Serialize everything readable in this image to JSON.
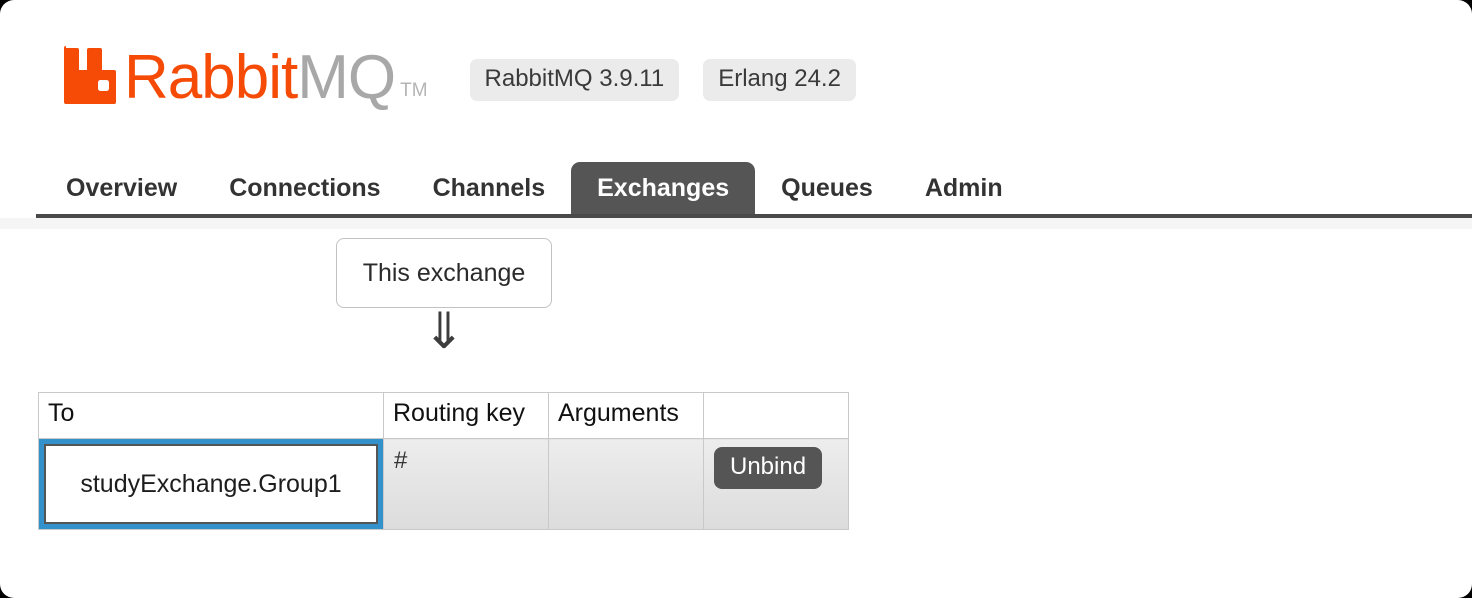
{
  "app": {
    "logo": {
      "mark_icon": "rabbitmq-bunny-icon",
      "text_primary": "Rabbit",
      "text_secondary": "MQ",
      "trademark": "TM"
    },
    "badges": [
      {
        "label": "RabbitMQ 3.9.11"
      },
      {
        "label": "Erlang 24.2"
      }
    ],
    "colors": {
      "brand_orange": "#f54b07",
      "logo_gray": "#a8a8a8",
      "tab_active_bg": "#555555",
      "selection_blue": "#3391cc",
      "button_bg": "#555555",
      "row_bg": "#e4e4e4"
    }
  },
  "nav": {
    "tabs": [
      {
        "label": "Overview",
        "active": false
      },
      {
        "label": "Connections",
        "active": false
      },
      {
        "label": "Channels",
        "active": false
      },
      {
        "label": "Exchanges",
        "active": true
      },
      {
        "label": "Queues",
        "active": false
      },
      {
        "label": "Admin",
        "active": false
      }
    ]
  },
  "diagram": {
    "exchange_box_label": "This exchange",
    "arrow_glyph": "⇓",
    "arrow_icon": "double-down-arrow-icon"
  },
  "bindings": {
    "columns": [
      {
        "label": "To"
      },
      {
        "label": "Routing key"
      },
      {
        "label": "Arguments"
      },
      {
        "label": ""
      }
    ],
    "rows": [
      {
        "to": "studyExchange.Group1",
        "routing_key": "#",
        "arguments": "",
        "action_label": "Unbind",
        "selected": true
      }
    ]
  }
}
